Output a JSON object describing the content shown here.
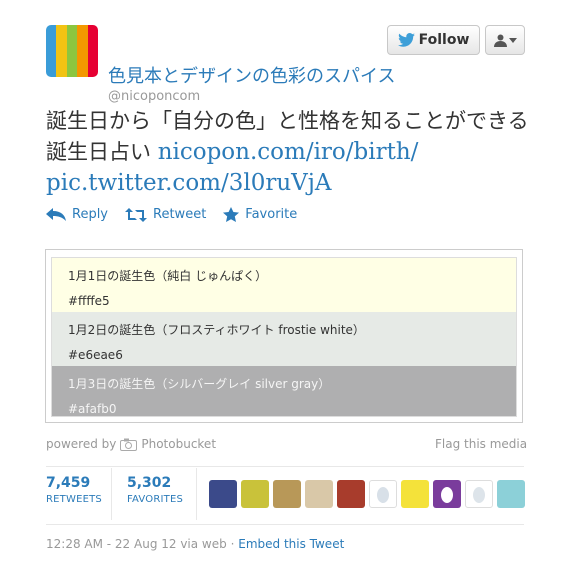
{
  "header": {
    "display_name": "色見本とデザインの色彩のスパイス",
    "handle": "@nicoponcom",
    "follow_label": "Follow",
    "avatar_colors": [
      "#3a9cd8",
      "#f2c313",
      "#8cc63f",
      "#f39800",
      "#e60033"
    ]
  },
  "tweet": {
    "line1": "誕生日から「自分の色」と性格を知ることができる",
    "line2_prefix": "誕生日占い",
    "link1": "nicopon.com/iro/birth/",
    "link2": "pic.twitter.com/3l0ruVjA"
  },
  "actions": {
    "reply": "Reply",
    "retweet": "Retweet",
    "favorite": "Favorite"
  },
  "media": {
    "swatches": [
      {
        "title": "1月1日の誕生色（純白 じゅんぱく）",
        "code": "#ffffe5",
        "bg": "#ffffe5",
        "fg": "#333333"
      },
      {
        "title": "1月2日の誕生色（フロスティホワイト frostie white）",
        "code": "#e6eae6",
        "bg": "#e6eae6",
        "fg": "#333333"
      },
      {
        "title": "1月3日の誕生色（シルバーグレイ silver gray）",
        "code": "#afafb0",
        "bg": "#afafb0",
        "fg": "#f5f5f5"
      }
    ],
    "powered_by": "powered by",
    "provider": "Photobucket",
    "flag": "Flag this media"
  },
  "stats": {
    "retweets_count": "7,459",
    "retweets_label": "RETWEETS",
    "favorites_count": "5,302",
    "favorites_label": "FAVORITES"
  },
  "faces": [
    {
      "name": "retweeter-avatar-1",
      "color": "#3b4a8a"
    },
    {
      "name": "retweeter-avatar-2",
      "color": "#c9c23a"
    },
    {
      "name": "retweeter-avatar-3",
      "color": "#b89858"
    },
    {
      "name": "retweeter-avatar-4",
      "color": "#d9c8a8"
    },
    {
      "name": "retweeter-avatar-5",
      "color": "#a83c2c"
    },
    {
      "name": "retweeter-avatar-6",
      "color": "#d8e0e8"
    },
    {
      "name": "retweeter-avatar-7",
      "color": "#f4e23a"
    },
    {
      "name": "retweeter-avatar-8",
      "color": "#7a3c9c"
    },
    {
      "name": "retweeter-avatar-9",
      "color": "#ffffff"
    },
    {
      "name": "retweeter-avatar-10",
      "color": "#8cd0d8"
    }
  ],
  "meta": {
    "timestamp": "12:28 AM - 22 Aug 12 via web",
    "separator": "·",
    "embed": "Embed this Tweet"
  }
}
